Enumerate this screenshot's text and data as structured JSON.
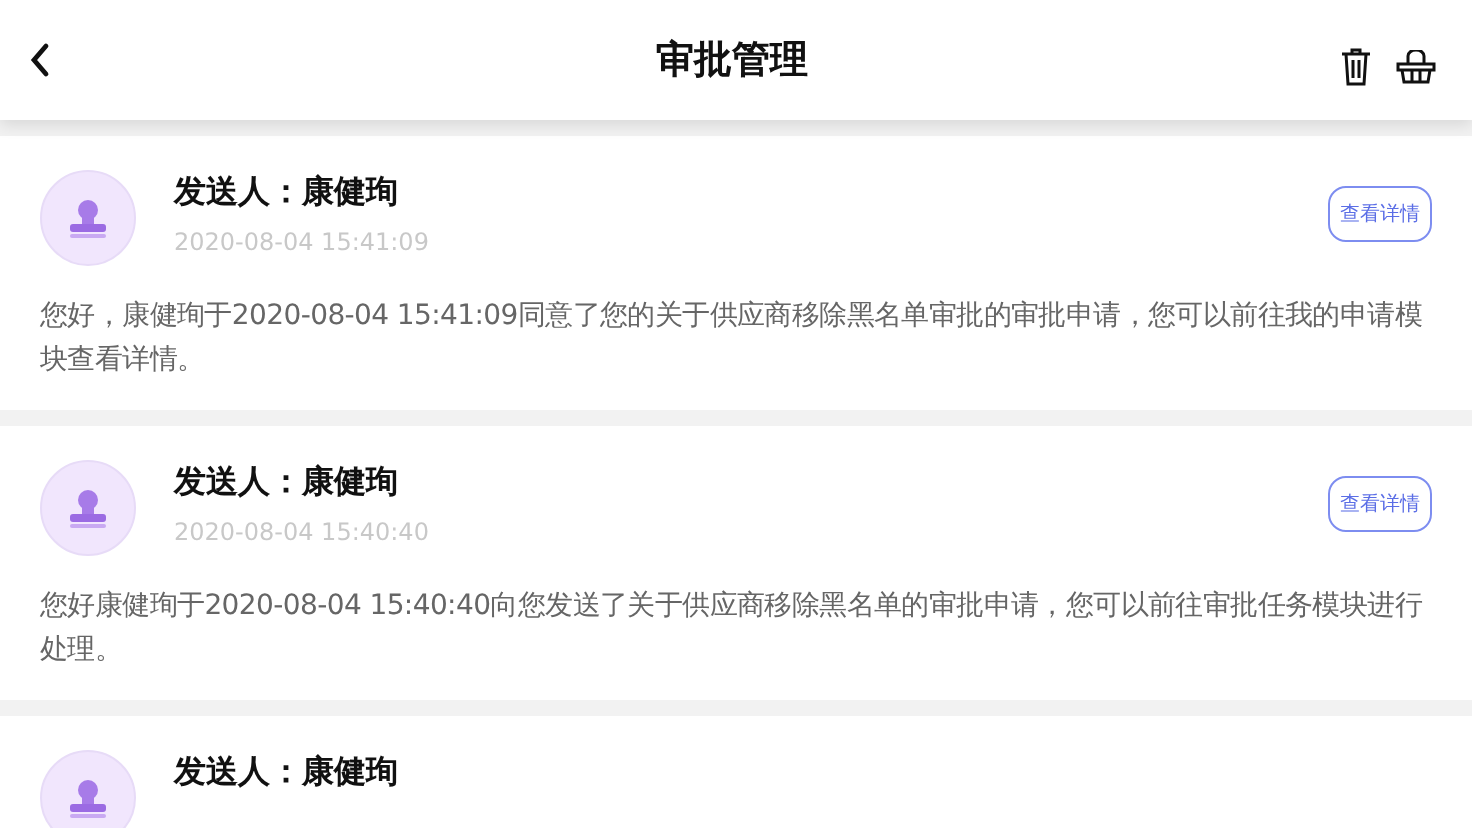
{
  "header": {
    "title": "审批管理"
  },
  "messages": [
    {
      "sender": "发送人：康健珣",
      "time": "2020-08-04 15:41:09",
      "button": "查看详情",
      "body": "您好，康健珣于2020-08-04 15:41:09同意了您的关于供应商移除黑名单审批的审批申请，您可以前往我的申请模块查看详情。"
    },
    {
      "sender": "发送人：康健珣",
      "time": "2020-08-04 15:40:40",
      "button": "查看详情",
      "body": "您好康健珣于2020-08-04 15:40:40向您发送了关于供应商移除黑名单的审批申请，您可以前往审批任务模块进行处理。"
    },
    {
      "sender": "发送人：康健珣"
    }
  ]
}
